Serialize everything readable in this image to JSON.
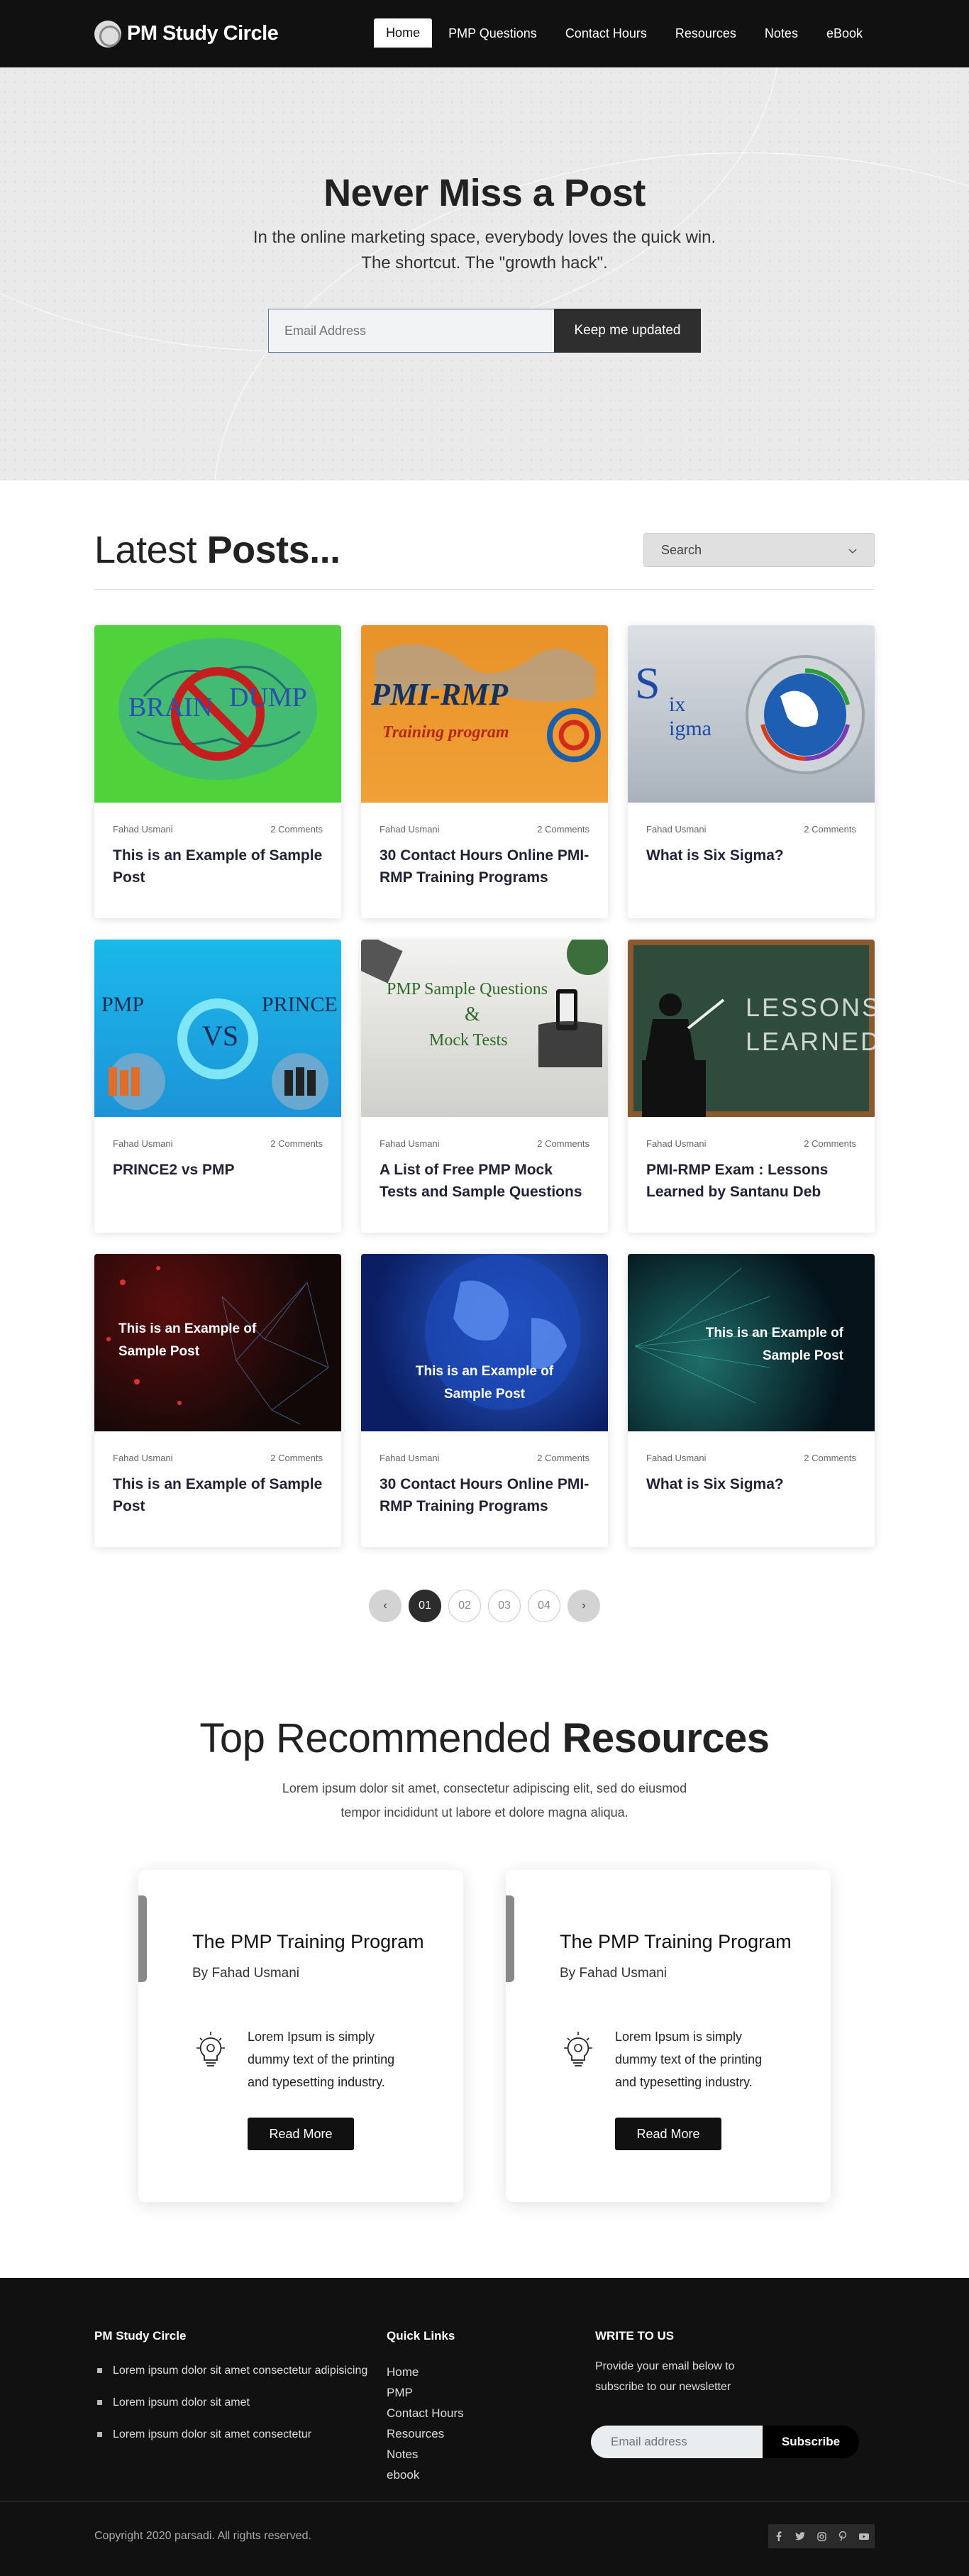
{
  "nav": {
    "brand": "PM Study Circle",
    "links": [
      "Home",
      "PMP Questions",
      "Contact Hours",
      "Resources",
      "Notes",
      "eBook"
    ]
  },
  "hero": {
    "title": "Never Miss a Post",
    "line1": "In the online marketing space, everybody loves the quick win.",
    "line2": "The shortcut. The \"growth hack\".",
    "email_placeholder": "Email Address",
    "button": "Keep me updated"
  },
  "latest": {
    "title_light": "Latest ",
    "title_bold": "Posts...",
    "search_label": "Search",
    "posts": [
      {
        "author": "Fahad Usmani",
        "comments": "2 Comments",
        "title": "This is an Example of Sample Post",
        "thumb_text": [
          "BRAIN",
          "DUMP"
        ]
      },
      {
        "author": "Fahad Usmani",
        "comments": "2 Comments",
        "title": "30 Contact Hours Online PMI-RMP Training Programs",
        "thumb_text": [
          "PMI-RMP",
          "Training program"
        ]
      },
      {
        "author": "Fahad Usmani",
        "comments": "2 Comments",
        "title": "What is Six Sigma?",
        "thumb_text": [
          "S",
          "ix",
          "igma"
        ]
      },
      {
        "author": "Fahad Usmani",
        "comments": "2 Comments",
        "title": "PRINCE2 vs PMP",
        "thumb_text": [
          "PMP",
          "PRINCE",
          "VS"
        ]
      },
      {
        "author": "Fahad Usmani",
        "comments": "2 Comments",
        "title": "A List of Free PMP Mock Tests and Sample Questions",
        "thumb_text": [
          "PMP Sample Questions",
          "&",
          "Mock Tests"
        ]
      },
      {
        "author": "Fahad Usmani",
        "comments": "2 Comments",
        "title": "PMI-RMP Exam : Lessons Learned by Santanu Deb",
        "thumb_text": [
          "LESSONS",
          "LEARNED"
        ]
      },
      {
        "author": "Fahad Usmani",
        "comments": "2 Comments",
        "title": "This is an Example of Sample Post",
        "thumb_text": [
          "This is an Example of",
          "Sample Post"
        ]
      },
      {
        "author": "Fahad Usmani",
        "comments": "2 Comments",
        "title": "30 Contact Hours Online PMI-RMP Training Programs",
        "thumb_text": [
          "This is an Example of",
          "Sample Post"
        ]
      },
      {
        "author": "Fahad Usmani",
        "comments": "2 Comments",
        "title": "What is Six Sigma?",
        "thumb_text": [
          "This is an Example of",
          "Sample Post"
        ]
      }
    ],
    "pager": {
      "prev": "‹",
      "pages": [
        "01",
        "02",
        "03",
        "04"
      ],
      "current": "01",
      "next": "›"
    }
  },
  "resources": {
    "title_light": "Top Recommended ",
    "title_bold": "Resources",
    "lead1": "Lorem ipsum dolor sit amet, consectetur adipiscing elit, sed do eiusmod",
    "lead2": "tempor incididunt ut labore et dolore magna aliqua.",
    "cards": [
      {
        "title": "The PMP Training Program",
        "by": "By Fahad Usmani",
        "text": "Lorem Ipsum is simply dummy text of the printing and typesetting industry.",
        "button": "Read More"
      },
      {
        "title": "The PMP Training Program",
        "by": "By Fahad Usmani",
        "text": "Lorem Ipsum is simply dummy text of the printing and typesetting industry.",
        "button": "Read More"
      }
    ]
  },
  "footer": {
    "col1_title": "PM Study Circle",
    "col1_items": [
      "Lorem ipsum dolor sit amet consectetur adipisicing",
      "Lorem ipsum dolor sit amet",
      "Lorem ipsum dolor sit amet consectetur"
    ],
    "col2_title": "Quick Links",
    "col2_items": [
      "Home",
      "PMP",
      "Contact Hours",
      "Resources",
      "Notes",
      "ebook"
    ],
    "col3_title": "WRITE TO US",
    "col3_text": "Provide your email below to subscribe to our newsletter",
    "email_placeholder": "Email address",
    "subscribe": "Subscribe",
    "copyright": "Copyright 2020 parsadi. All rights reserved.",
    "social": [
      "f",
      "t",
      "ig",
      "p",
      "yt"
    ]
  }
}
